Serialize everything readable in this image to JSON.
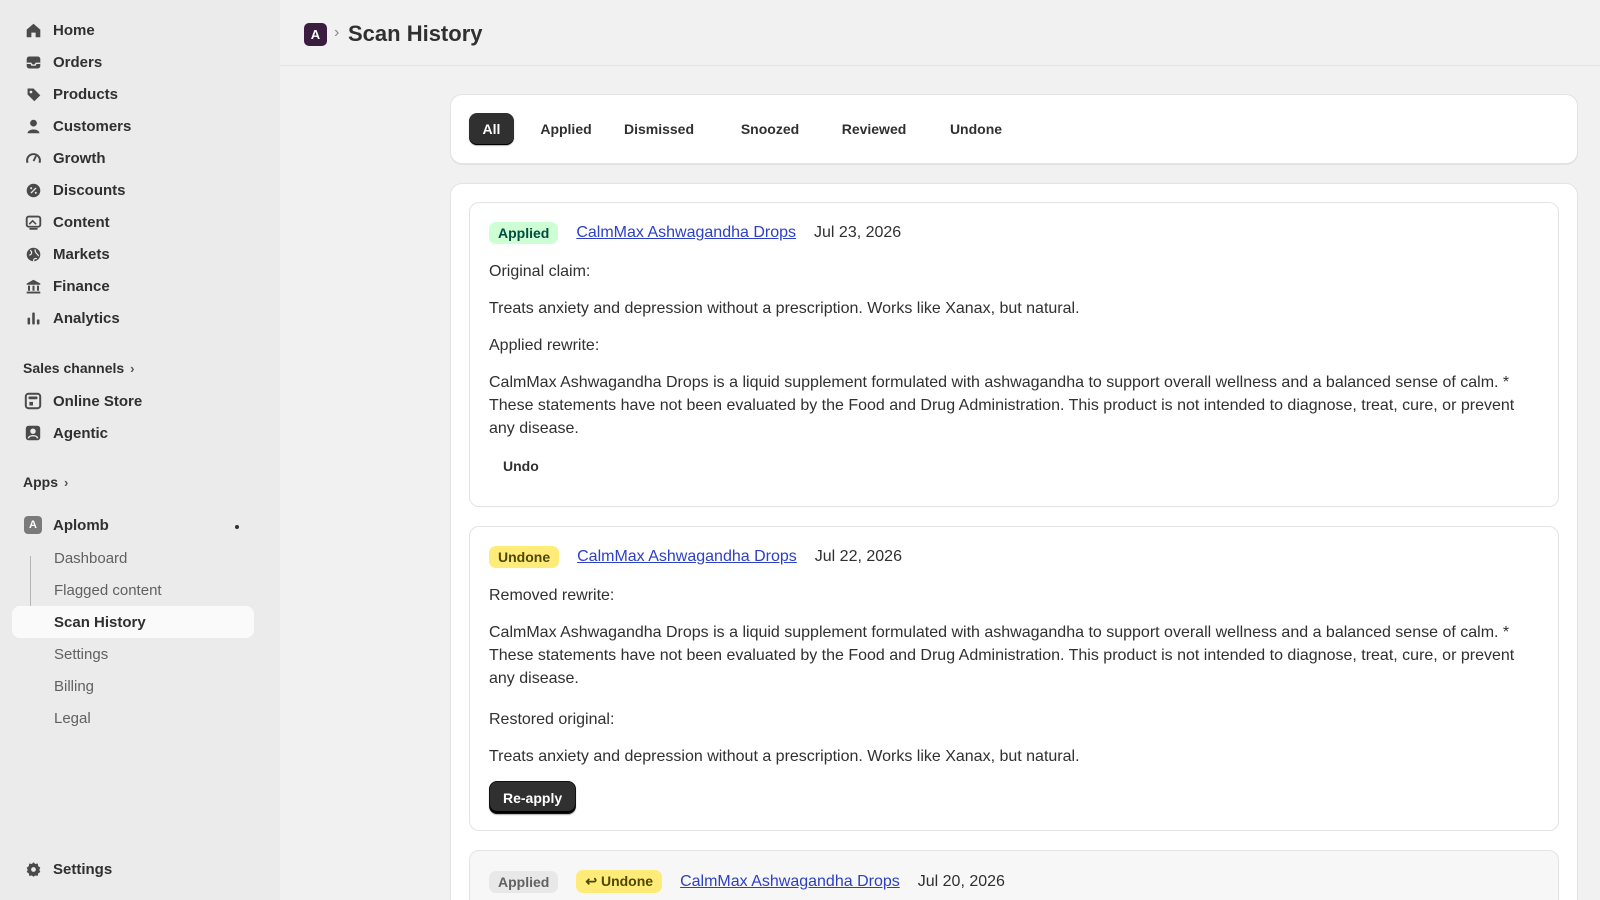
{
  "sidebar": {
    "nav": [
      {
        "label": "Home",
        "icon": "home-icon"
      },
      {
        "label": "Orders",
        "icon": "inbox-icon"
      },
      {
        "label": "Products",
        "icon": "tag-icon"
      },
      {
        "label": "Customers",
        "icon": "person-icon"
      },
      {
        "label": "Growth",
        "icon": "gauge-icon"
      },
      {
        "label": "Discounts",
        "icon": "discount-icon"
      },
      {
        "label": "Content",
        "icon": "image-icon"
      },
      {
        "label": "Markets",
        "icon": "globe-icon"
      },
      {
        "label": "Finance",
        "icon": "bank-icon"
      },
      {
        "label": "Analytics",
        "icon": "bar-chart-icon"
      }
    ],
    "sales_channels_label": "Sales channels",
    "channels": [
      {
        "label": "Online Store",
        "icon": "store-icon"
      },
      {
        "label": "Agentic",
        "icon": "agentic-icon"
      }
    ],
    "apps_label": "Apps",
    "app": {
      "label": "Aplomb",
      "logo_letter": "A"
    },
    "app_pages": [
      {
        "label": "Dashboard"
      },
      {
        "label": "Flagged content"
      },
      {
        "label": "Scan History"
      },
      {
        "label": "Settings"
      },
      {
        "label": "Billing"
      },
      {
        "label": "Legal"
      }
    ],
    "settings_label": "Settings"
  },
  "header": {
    "brand_letter": "A",
    "separator": "›",
    "title": "Scan History"
  },
  "tabs": [
    "All",
    "Applied",
    "Dismissed",
    "Snoozed",
    "Reviewed",
    "Undone"
  ],
  "active_tab": "All",
  "entries": [
    {
      "badge": "Applied",
      "product": "CalmMax Ashwagandha Drops",
      "date": "Jul 23, 2026",
      "label1": "Original claim:",
      "text1": "Treats anxiety and depression without a prescription. Works like Xanax, but natural.",
      "label2": "Applied rewrite:",
      "text2": "CalmMax Ashwagandha Drops is a liquid supplement formulated with ashwagandha to support overall wellness and a balanced sense of calm. * These statements have not been evaluated by the Food and Drug Administration. This product is not intended to diagnose, treat, cure, or prevent any disease.",
      "action": "Undo"
    },
    {
      "badge": "Undone",
      "product": "CalmMax Ashwagandha Drops",
      "date": "Jul 22, 2026",
      "label1": "Removed rewrite:",
      "text1": "CalmMax Ashwagandha Drops is a liquid supplement formulated with ashwagandha to support overall wellness and a balanced sense of calm. * These statements have not been evaluated by the Food and Drug Administration. This product is not intended to diagnose, treat, cure, or prevent any disease.",
      "label2": "Restored original:",
      "text2": "Treats anxiety and depression without a prescription. Works like Xanax, but natural.",
      "action": "Re-apply"
    },
    {
      "badge": "Applied",
      "badge2": "↩ Undone",
      "product": "CalmMax Ashwagandha Drops",
      "date": "Jul 20, 2026"
    }
  ]
}
